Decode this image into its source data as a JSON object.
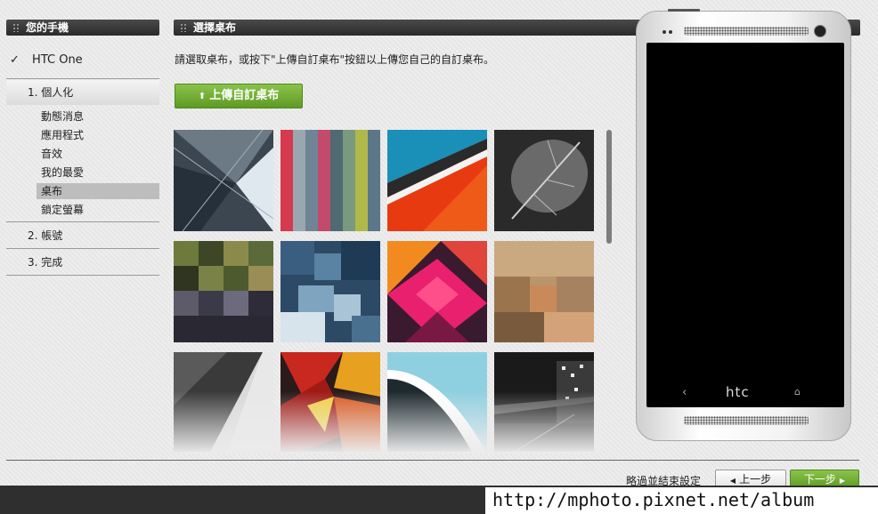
{
  "sidebar": {
    "title": "您的手機",
    "phone_name": "HTC One",
    "check_mark": "✓",
    "steps": [
      {
        "label": "1. 個人化"
      },
      {
        "label": "2. 帳號"
      },
      {
        "label": "3. 完成"
      }
    ],
    "sub_items": [
      "動態消息",
      "應用程式",
      "音效",
      "我的最愛",
      "桌布",
      "鎖定螢幕"
    ],
    "selected_sub": "桌布"
  },
  "main": {
    "title": "選擇桌布",
    "instruction": "請選取桌布，或按下\"上傳自訂桌布\"按鈕以上傳您自己的自訂桌布。",
    "upload_icon": "⬆",
    "upload_label": "上傳自訂桌布"
  },
  "phone": {
    "brand": "htc",
    "back_glyph": "‹",
    "home_glyph": "⌂"
  },
  "footer": {
    "skip_label": "略過並結束設定",
    "prev_label": "上一步",
    "next_label": "下一步",
    "prev_glyph": "◀",
    "next_glyph": "▶"
  },
  "watermark": "http://mphoto.pixnet.net/album",
  "colors": {
    "accent_green": "#6aab2e",
    "header_dark": "#333333",
    "selected_gray": "#bdbdbd"
  }
}
